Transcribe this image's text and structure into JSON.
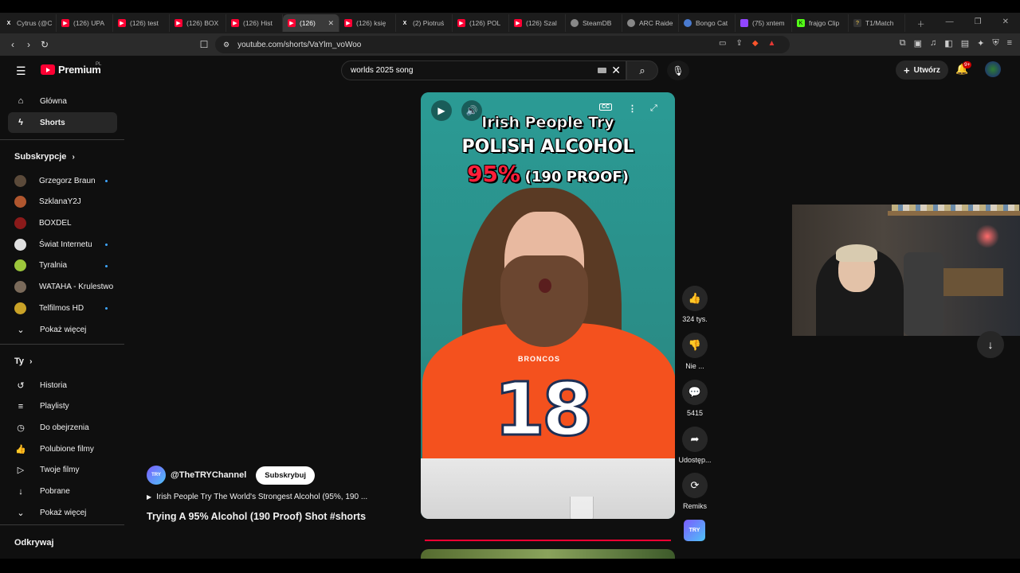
{
  "browser": {
    "tabs": [
      {
        "label": "Cytrus (@C",
        "icon": "x-icon"
      },
      {
        "label": "(126) UPA",
        "icon": "youtube-icon"
      },
      {
        "label": "(126) test",
        "icon": "youtube-icon"
      },
      {
        "label": "(126) BOX",
        "icon": "youtube-icon"
      },
      {
        "label": "(126) Hist",
        "icon": "youtube-icon"
      },
      {
        "label": "(126)",
        "icon": "youtube-icon",
        "active": true
      },
      {
        "label": "(126) księ",
        "icon": "youtube-icon"
      },
      {
        "label": "(2) Piotruś",
        "icon": "x-icon"
      },
      {
        "label": "(126) POL",
        "icon": "youtube-icon"
      },
      {
        "label": "(126) Szal",
        "icon": "youtube-icon"
      },
      {
        "label": "SteamDB",
        "icon": "steam-icon"
      },
      {
        "label": "ARC Raide",
        "icon": "steam-icon"
      },
      {
        "label": "Bongo Cat",
        "icon": "bongo-icon"
      },
      {
        "label": "(75) xntem",
        "icon": "twitch-icon"
      },
      {
        "label": "frajgo Clip",
        "icon": "kick-icon"
      },
      {
        "label": "T1/Match",
        "icon": "t1-icon"
      }
    ],
    "url": "youtube.com/shorts/VaYlm_voWoo"
  },
  "masthead": {
    "brand": "Premium",
    "region": "PL",
    "search_value": "worlds 2025 song",
    "create_label": "Utwórz",
    "notif_count": "9+"
  },
  "sidebar": {
    "main": [
      {
        "label": "Główna",
        "icon": "home-icon"
      },
      {
        "label": "Shorts",
        "icon": "shorts-icon"
      }
    ],
    "subs_header": "Subskrypcje",
    "subs": [
      {
        "label": "Grzegorz Braun",
        "color": "#5b4a3a",
        "dot": true
      },
      {
        "label": "SzklanaY2J",
        "color": "#b0562e",
        "dot": false
      },
      {
        "label": "BOXDEL",
        "color": "#8b1a1a",
        "dot": false
      },
      {
        "label": "Świat Internetu",
        "color": "#e0e0e0",
        "dot": true
      },
      {
        "label": "Tyralnia",
        "color": "#9cc63b",
        "dot": true
      },
      {
        "label": "WATAHA - Krulestwo",
        "color": "#7a6a5a",
        "dot": false
      },
      {
        "label": "Telfilmos HD",
        "color": "#c9a227",
        "dot": true
      }
    ],
    "show_more": "Pokaż więcej",
    "you_header": "Ty",
    "you": [
      {
        "label": "Historia",
        "icon": "history-icon"
      },
      {
        "label": "Playlisty",
        "icon": "playlist-icon"
      },
      {
        "label": "Do obejrzenia",
        "icon": "clock-icon"
      },
      {
        "label": "Polubione filmy",
        "icon": "like-icon"
      },
      {
        "label": "Twoje filmy",
        "icon": "video-icon"
      },
      {
        "label": "Pobrane",
        "icon": "download-icon"
      },
      {
        "label": "Pokaż więcej",
        "icon": "chevron-down-icon"
      }
    ],
    "explore_header": "Odkrywaj"
  },
  "video": {
    "caption_line1": "Irish People Try",
    "caption_line2": "POLISH ALCOHOL",
    "caption_pct": "95%",
    "caption_proof": "(190 PROOF)",
    "jersey_text": "BRONCOS",
    "jersey_number": "18",
    "cc_label": "CC"
  },
  "actions": {
    "likes": "324 tys.",
    "dislike": "Nie ...",
    "comments": "5415",
    "share": "Udostęp...",
    "remix": "Remiks",
    "channel_badge": "TRY"
  },
  "meta": {
    "channel": "@TheTRYChannel",
    "avatar_text": "TRY",
    "subscribe": "Subskrybuj",
    "song": "Irish People Try The World's Strongest Alcohol (95%, 190 ...",
    "title": "Trying A 95% Alcohol (190 Proof) Shot #shorts"
  }
}
